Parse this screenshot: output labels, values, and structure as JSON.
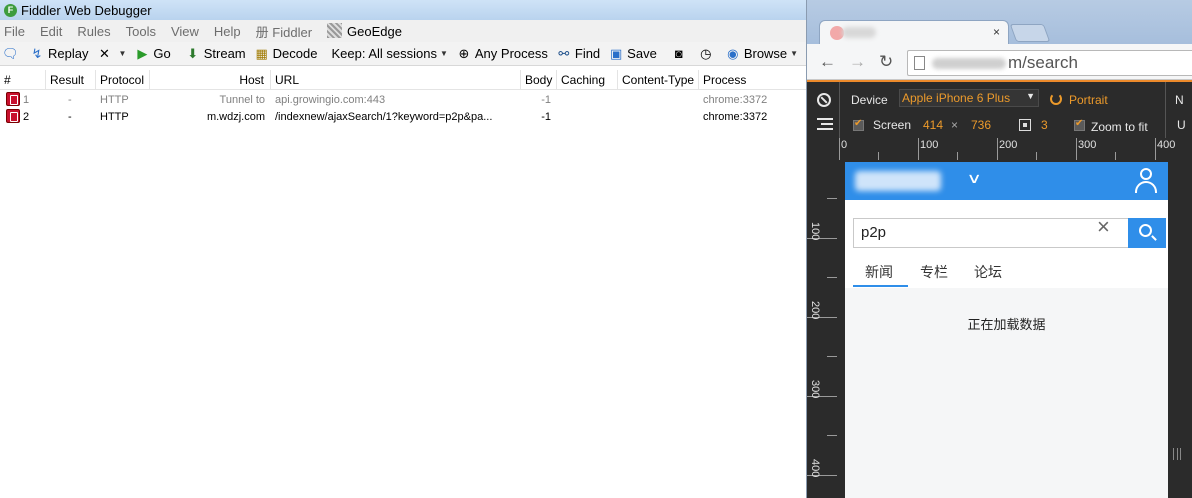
{
  "fiddler": {
    "title": "Fiddler Web Debugger",
    "menu": [
      "File",
      "Edit",
      "Rules",
      "Tools",
      "View",
      "Help",
      "册 Fiddler",
      "GeoEdge"
    ],
    "toolbar": {
      "replay": "Replay",
      "go": "Go",
      "stream": "Stream",
      "decode": "Decode",
      "keep": "Keep: All sessions",
      "any_process": "Any Process",
      "find": "Find",
      "save": "Save",
      "browse": "Browse"
    },
    "columns": [
      "#",
      "Result",
      "Protocol",
      "Host",
      "URL",
      "Body",
      "Caching",
      "Content-Type",
      "Process"
    ],
    "sessions": [
      {
        "id": "1",
        "result": "-",
        "protocol": "HTTP",
        "host": "Tunnel to",
        "url": "api.growingio.com:443",
        "body": "-1",
        "caching": "",
        "content_type": "",
        "process": "chrome:3372"
      },
      {
        "id": "2",
        "result": "-",
        "protocol": "HTTP",
        "host": "m.wdzj.com",
        "url": "/indexnew/ajaxSearch/1?keyword=p2p&pa...",
        "body": "-1",
        "caching": "",
        "content_type": "",
        "process": "chrome:3372"
      }
    ]
  },
  "chrome": {
    "tab_close": "×",
    "address_suffix": "m/search",
    "devtools": {
      "device_label": "Device",
      "device_value": "Apple iPhone 6 Plus",
      "orientation": "Portrait",
      "cut_label": "N",
      "screen_label": "Screen",
      "screen_width": "414",
      "times": "×",
      "screen_height": "736",
      "dpr": "3",
      "zoom_label": "Zoom to fit",
      "cut_label2": "U",
      "ruler_top": [
        "0",
        "100",
        "200",
        "300",
        "400"
      ],
      "ruler_left": [
        "100",
        "200",
        "300",
        "400"
      ]
    },
    "page": {
      "search_value": "p2p",
      "tabs": [
        "新闻",
        "专栏",
        "论坛"
      ],
      "loading": "正在加载数据"
    }
  },
  "icons": {
    "fiddler_app": "fiddler-icon",
    "session": "session-icon"
  },
  "colors": {
    "mobile_accent": "#2f8ee9",
    "devtools_accent": "#ec9a2b",
    "session_icon": "#c8102e"
  }
}
